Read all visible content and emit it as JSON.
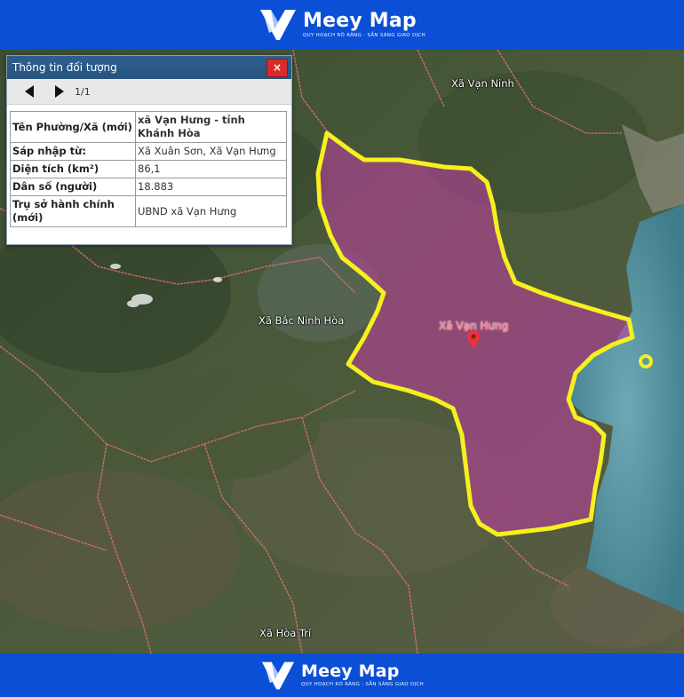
{
  "brand": {
    "name": "Meey Map",
    "tagline": "QUY HOẠCH RÕ RÀNG - SẴN SÀNG GIAO DỊCH"
  },
  "colors": {
    "banner": "#0a4fd6",
    "boundary": "#f5f01e",
    "highlight_fill": "#b5409a",
    "admin_line": "#e8736a",
    "panel_header": "#2f5f8f",
    "close_button": "#d62c2c"
  },
  "panel": {
    "title": "Thông tin đối tượng",
    "close_icon": "×",
    "prev_icon": "triangle-left",
    "next_icon": "triangle-right",
    "page": "1/1",
    "rows": [
      {
        "key": "Tên Phường/Xã (mới)",
        "value": "xã Vạn Hưng - tỉnh Khánh Hòa"
      },
      {
        "key": "Sáp nhập từ:",
        "value": "Xã Xuân Sơn, Xã Vạn Hưng"
      },
      {
        "key": "Diện tích (km²)",
        "value": "86,1"
      },
      {
        "key": "Dân số (người)",
        "value": "18.883"
      },
      {
        "key": "Trụ sở hành chính (mới)",
        "value": "UBND xã Vạn Hưng"
      }
    ]
  },
  "map": {
    "labels": {
      "van_ninh": "Xã Vạn Ninh",
      "bac_ninh_hoa": "Xã Bắc Ninh Hòa",
      "van_hung": "Xã Vạn Hưng",
      "hoa_tri": "Xã Hòa Trí"
    },
    "marker_icon": "map-pin"
  }
}
